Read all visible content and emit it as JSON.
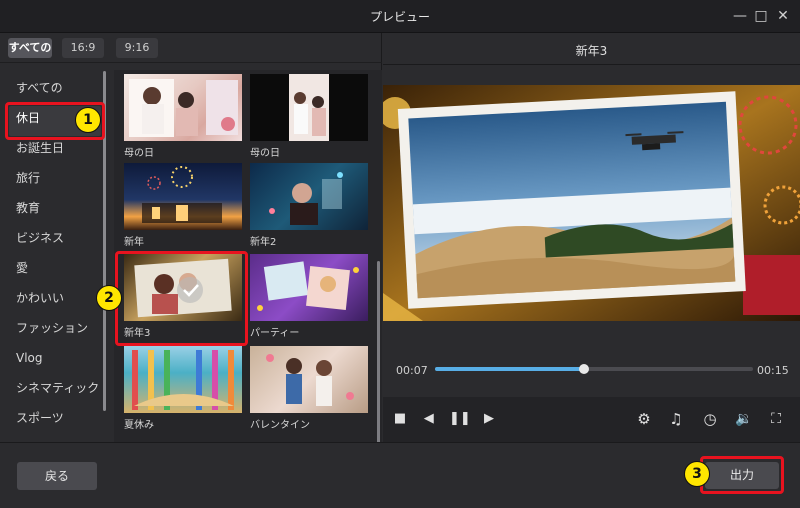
{
  "window": {
    "title": "プレビュー"
  },
  "ratios": [
    "すべての",
    "16:9",
    "9:16"
  ],
  "categories": [
    "すべての",
    "休日",
    "お誕生日",
    "旅行",
    "教育",
    "ビジネス",
    "愛",
    "かわいい",
    "ファッション",
    "Vlog",
    "シネマティック",
    "スポーツ"
  ],
  "templates": [
    "母の日",
    "母の日",
    "新年",
    "新年2",
    "新年3",
    "パーティー",
    "夏休み",
    "バレンタイン"
  ],
  "badges": [
    "1",
    "2",
    "3"
  ],
  "preview": {
    "title": "新年3",
    "current_time": "00:07",
    "total_time": "00:15",
    "progress": 0.47
  },
  "footer": {
    "back_label": "戻る",
    "export_label": "出力"
  },
  "colors": {
    "accent": "#58aee6",
    "highlight": "#e8131f",
    "badge": "#ffe600"
  }
}
